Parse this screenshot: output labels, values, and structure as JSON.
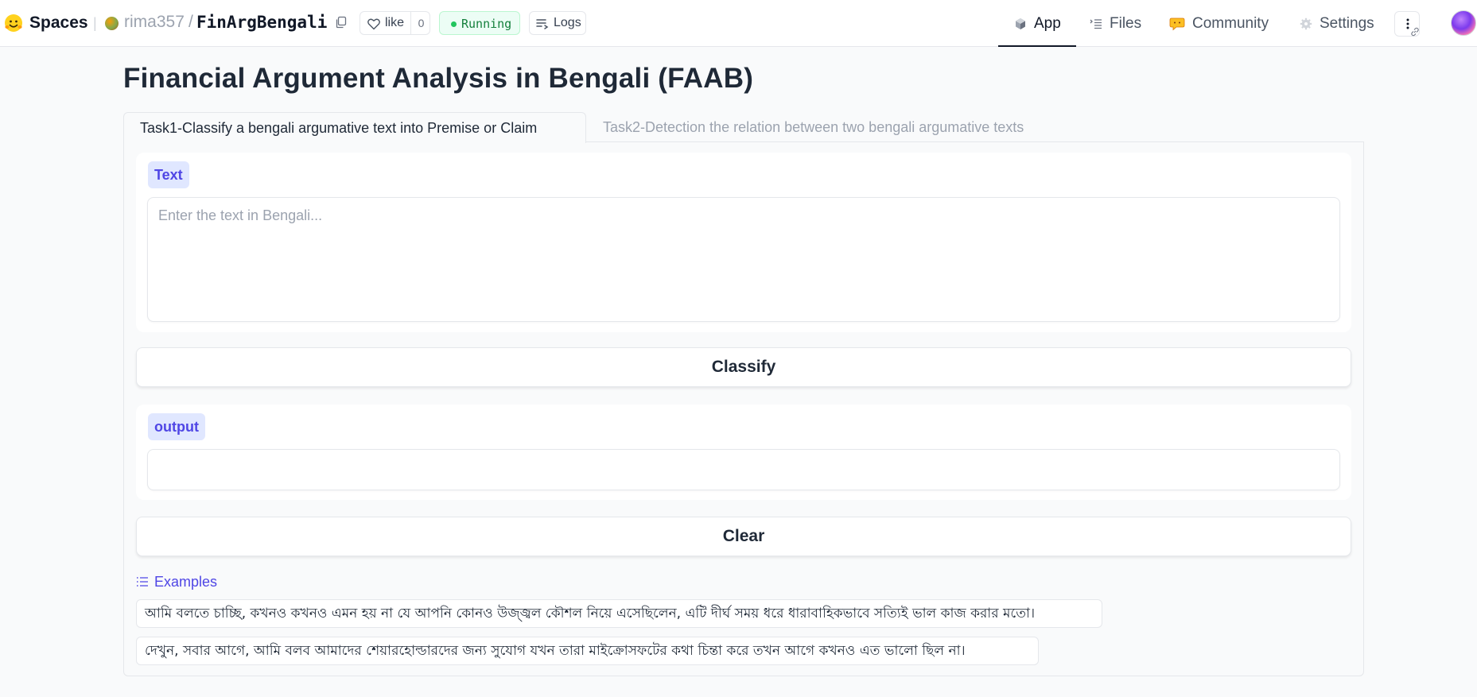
{
  "header": {
    "brand": "Spaces",
    "brand_icon": "hugging-face-icon",
    "owner": "rima357",
    "separator": "/",
    "repo": "FinArgBengali",
    "like_label": "like",
    "like_count": "0",
    "status": "Running",
    "status_color": "#22c55e",
    "logs_label": "Logs",
    "nav": {
      "app": "App",
      "files": "Files",
      "community": "Community",
      "settings": "Settings"
    }
  },
  "main": {
    "title": "Financial Argument Analysis in Bengali (FAAB)",
    "tabs": [
      {
        "label": "Task1-Classify a bengali argumative text into Premise or Claim",
        "active": true
      },
      {
        "label": "Task2-Detection the relation between two bengali argumative texts",
        "active": false
      }
    ],
    "text_input": {
      "label": "Text",
      "placeholder": "Enter the text in Bengali...",
      "value": ""
    },
    "classify_label": "Classify",
    "output": {
      "label": "output",
      "value": ""
    },
    "clear_label": "Clear",
    "examples": {
      "label": "Examples",
      "items": [
        "আমি বলতে চাচ্ছি, কখনও কখনও এমন হয় না যে আপনি কোনও উজ্জ্বল কৌশল নিয়ে এসেছিলেন, এটি দীর্ঘ সময় ধরে ধারাবাহিকভাবে সত্যিই ভাল কাজ করার মতো।",
        "দেখুন, সবার আগে, আমি বলব আমাদের শেয়ারহোল্ডারদের জন্য সুযোগ যখন তারা মাইক্রোসফটের কথা চিন্তা করে তখন আগে কখনও এত ভালো ছিল না।"
      ]
    }
  },
  "colors": {
    "accent": "#4f46e5",
    "chip_bg": "#e0e7ff",
    "page_bg": "#f9fafb"
  }
}
